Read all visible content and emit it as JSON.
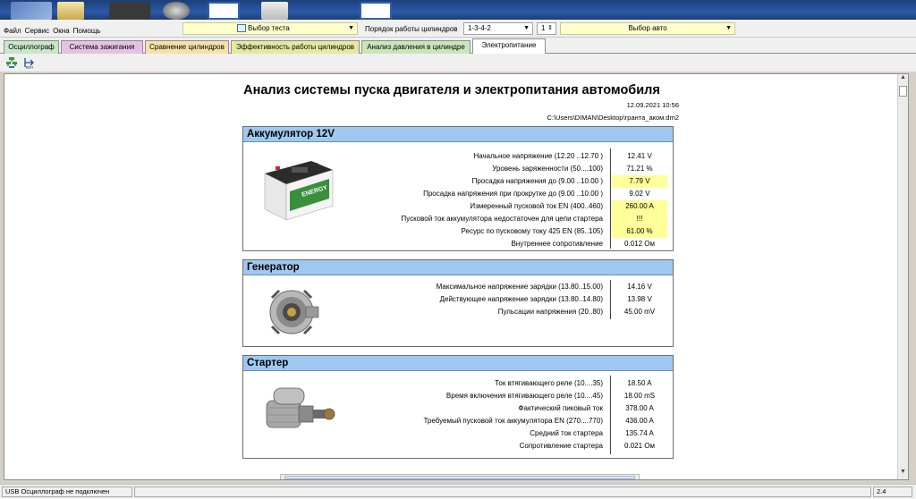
{
  "menu": {
    "items": [
      "Файл",
      "Сервис",
      "Окна",
      "Помощь"
    ]
  },
  "selectors": {
    "test_label": "Выбор теста",
    "cylinder_order_label": "Порядок работы цилиндров",
    "cylinder_order_value": "1-3-4-2",
    "cylinder_number": "1",
    "auto_label": "Выбор авто"
  },
  "tabs": [
    {
      "label": "Осциллограф",
      "color": "#c8e6c8"
    },
    {
      "label": "Система зажигания",
      "color": "#e5c2e5"
    },
    {
      "label": "Сравнение цилиндров",
      "color": "#f5e0a8"
    },
    {
      "label": "Эффективность работы цилиндров",
      "color": "#e6e8a0"
    },
    {
      "label": "Анализ давления в цилиндре",
      "color": "#c8e6b8"
    },
    {
      "label": "Электропитание",
      "color": "#ffffff",
      "active": true
    }
  ],
  "report": {
    "title": "Анализ системы пуска двигателя и электропитания автомобиля",
    "date": "12.09.2021 10:56",
    "path": "C:\\Users\\DIMAN\\Desktop\\гранта_аком.dm2",
    "battery": {
      "title": "Аккумулятор 12V",
      "rows": [
        {
          "label": "Начальное напряжение (12.20 ..12.70 )",
          "value": "12.41 V",
          "highlight": false
        },
        {
          "label": "Уровень заряженности (50....100)",
          "value": "71.21 %",
          "highlight": false
        },
        {
          "label": "Просадка напряжения до (9.00 ..10.00 )",
          "value": "7.79 V",
          "highlight": true
        },
        {
          "label": "Просадка напряжения при прокрутке до (9.00 ..10.00 )",
          "value": "9.02 V",
          "highlight": false
        },
        {
          "label": "Измеренный пусковой ток  EN (400..460)",
          "value": "260.00 A",
          "highlight": true
        },
        {
          "label": "Пусковой ток аккумулятора недостаточен для цепи стартера",
          "value": "!!!",
          "highlight": true
        },
        {
          "label": "Ресурс по пусковому току  425 EN (85..105)",
          "value": "61.00 %",
          "highlight": true
        },
        {
          "label": "Внутреннее сопротивление",
          "value": "0.012 Ом",
          "highlight": false
        }
      ]
    },
    "generator": {
      "title": "Генератор",
      "rows": [
        {
          "label": "Максимальное напряжение зарядки  (13.80..15.00)",
          "value": "14.16 V",
          "highlight": false
        },
        {
          "label": "Действующее напряжение зарядки (13.80..14.80)",
          "value": "13.98 V",
          "highlight": false
        },
        {
          "label": "Пульсации напряжения (20..80)",
          "value": "45.00 mV",
          "highlight": false
        }
      ]
    },
    "starter": {
      "title": "Стартер",
      "rows": [
        {
          "label": "Ток втягивающего реле (10....35)",
          "value": "18.50 A",
          "highlight": false
        },
        {
          "label": "Время включения втягивающего реле (10....45)",
          "value": "18.00 mS",
          "highlight": false
        },
        {
          "label": "Фактический пиковый ток",
          "value": "378.00 A",
          "highlight": false
        },
        {
          "label": "Требуемый пусковой ток аккумулятора  EN (270....770)",
          "value": "436.00 A",
          "highlight": false
        },
        {
          "label": "Средний ток стартера",
          "value": "135.74 A",
          "highlight": false
        },
        {
          "label": "Сопротивление стартера",
          "value": "0.021 Ом",
          "highlight": false
        }
      ]
    }
  },
  "status": {
    "connection": "USB Осциллограф не подключен",
    "version": "2.4"
  }
}
